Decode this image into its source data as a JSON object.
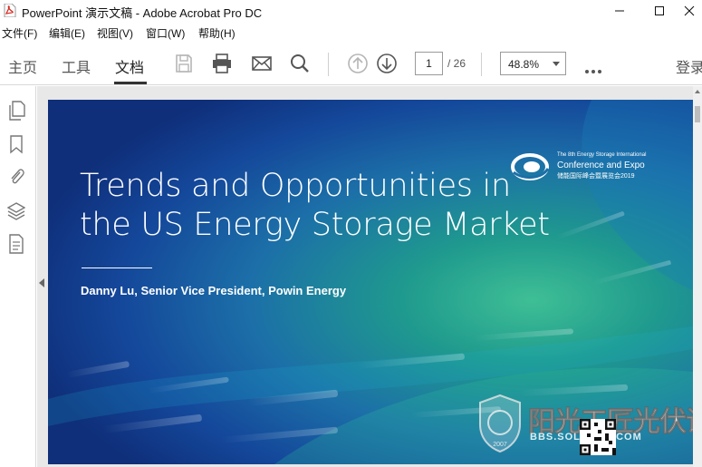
{
  "window": {
    "title": "PowerPoint 演示文稿 - Adobe Acrobat Pro DC"
  },
  "menu": {
    "items": [
      "文件(F)",
      "编辑(E)",
      "视图(V)",
      "窗口(W)",
      "帮助(H)"
    ]
  },
  "toolbar": {
    "tabs": [
      "主页",
      "工具",
      "文档"
    ],
    "active_tab": "文档",
    "page_current": "1",
    "page_total": "/ 26",
    "zoom": "48.8%",
    "login": "登录"
  },
  "slide": {
    "title_line1": "Trends and Opportunities in",
    "title_line2": "the US Energy Storage Market",
    "subtitle": "Danny Lu, Senior Vice President, Powin Energy",
    "conf_line1": "The 8th Energy Storage International",
    "conf_line2": "Conference and Expo",
    "conf_line3": "储能国际峰会暨展览会2019"
  },
  "watermark": {
    "text": "阳光工匠光伏论坛",
    "sub": "BBS.SOLARBE.COM",
    "year": "2007"
  },
  "colors": {
    "slide_dark": "#0f2f7a",
    "slide_mid": "#1c6fa8",
    "slide_green": "#3fbf95",
    "pdf_red": "#d4251c"
  }
}
